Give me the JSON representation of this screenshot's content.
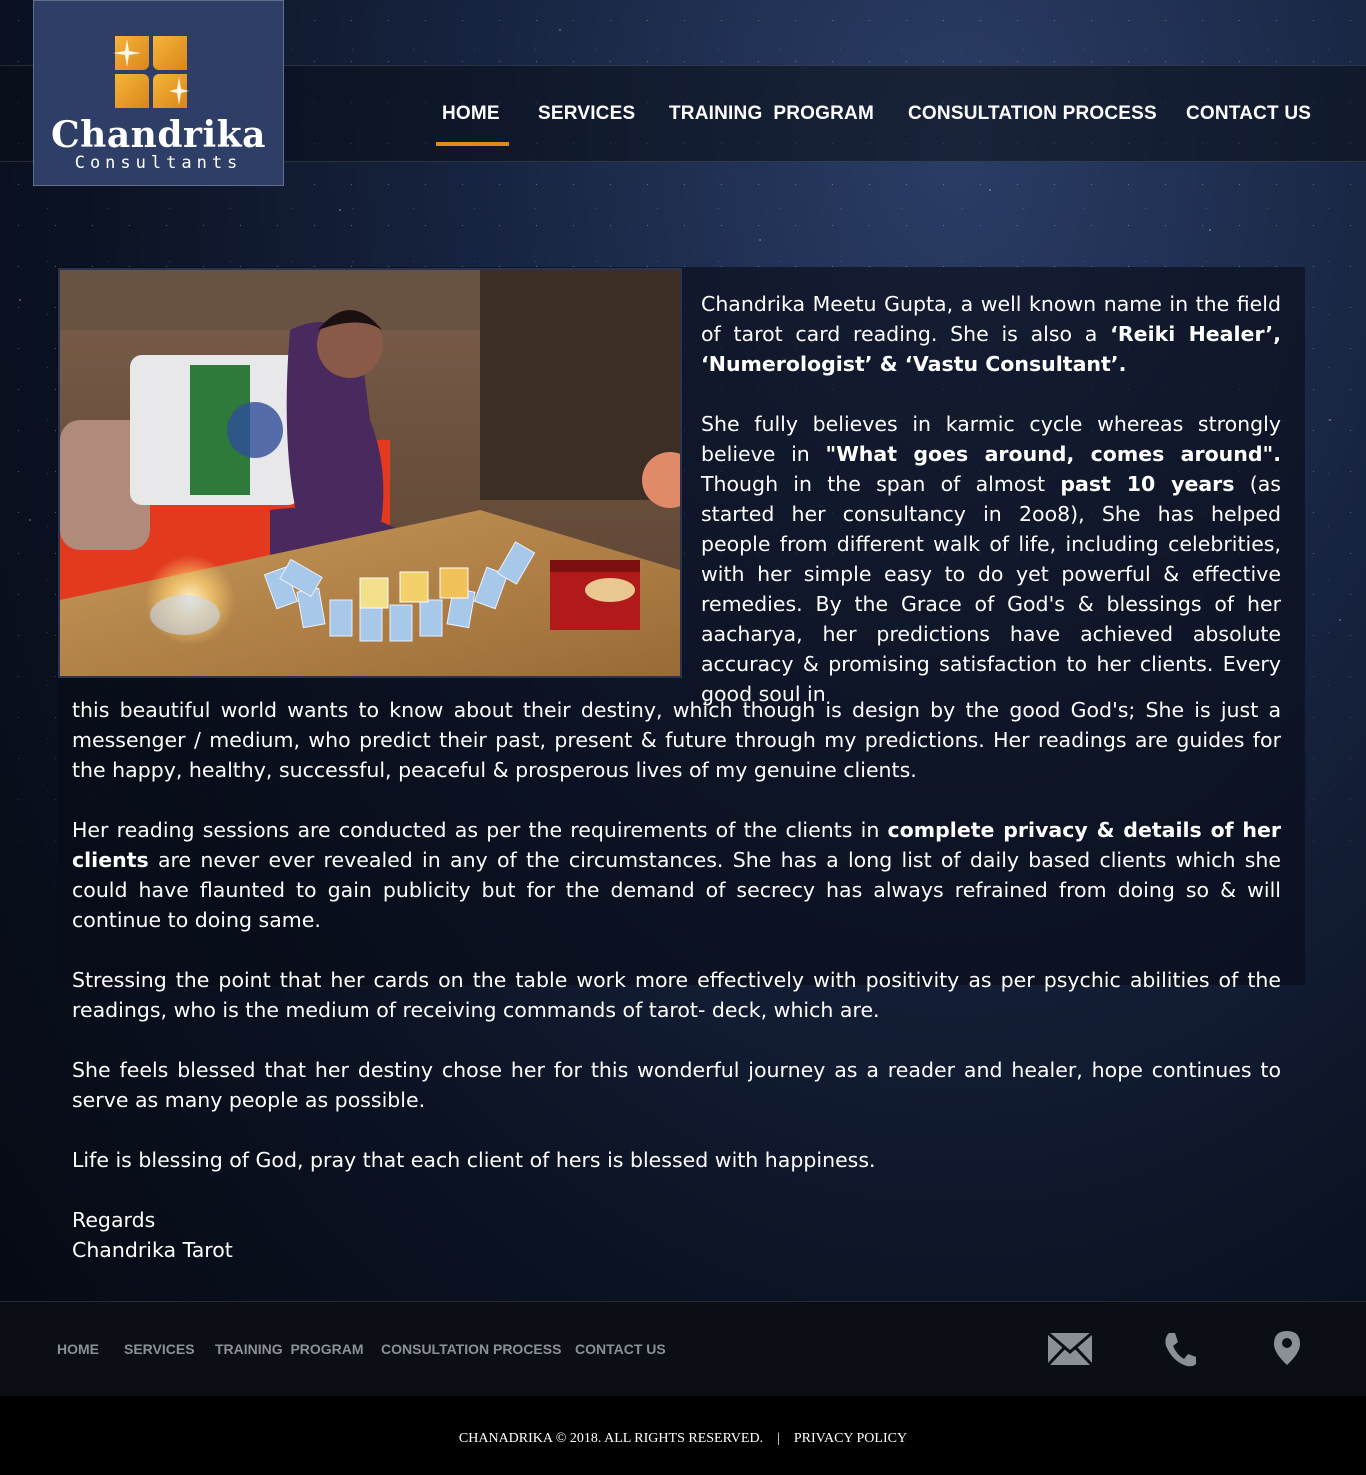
{
  "brand": {
    "name": "Chandrika",
    "tagline": "Consultants"
  },
  "nav": {
    "items": [
      "HOME",
      "SERVICES",
      "TRAINING  PROGRAM",
      "CONSULTATION PROCESS",
      "CONTACT US"
    ],
    "active": "HOME"
  },
  "content": {
    "p1": {
      "a": "Chandrika Meetu Gupta, a well known name in the field of tarot card reading. She is also a ",
      "b": "‘Reiki Healer’, ‘Numerologist’ & ‘Vastu Consultant’",
      "c": "."
    },
    "p2": {
      "a": "She fully believes in karmic cycle whereas strongly believe in ",
      "b": "\"What goes around, comes around\".",
      "c": " Though in the span of almost ",
      "d": "past 10 years",
      "e": " (as started her consultancy in 2oo8), She has helped people from different walk of life, including celebrities, with her simple easy to do yet powerful & effective remedies. By the Grace of God's & blessings of her aacharya, her predictions have achieved absolute accuracy & promising satisfaction to her clients. Every good soul in"
    },
    "p3": " this beautiful world wants to know about their destiny, which though is design by the good God's; She is just a messenger / medium, who predict their past, present & future through my predictions. Her readings are guides for the happy, healthy, successful, peaceful & prosperous lives of my  genuine clients.",
    "p4": {
      "a": "Her reading sessions are conducted as per the requirements of the clients in ",
      "b": "complete privacy & details of her clients",
      "c": " are never ever revealed in any of the circumstances. She has a long list of daily based clients which she could have flaunted to gain publicity but for the demand of secrecy has always refrained from doing so & will continue to doing same."
    },
    "p5": "Stressing the point that her cards on the table work more effectively with positivity as per psychic abilities of the readings, who is the medium of receiving commands of tarot- deck, which are.",
    "p6": "She feels blessed that her destiny chose her for this wonderful journey as a reader and healer, hope continues to serve as many people as possible.",
    "p7": "Life is blessing of God, pray that each client of hers is blessed with happiness.",
    "regards": "Regards",
    "signature": "Chandrika Tarot"
  },
  "footer": {
    "nav": [
      "HOME",
      "SERVICES",
      "TRAINING  PROGRAM",
      "CONSULTATION PROCESS",
      "CONTACT US"
    ],
    "icons": [
      "mail-icon",
      "phone-icon",
      "location-pin-icon"
    ],
    "copyright": "CHANADRIKA © 2018. ALL RIGHTS RESERVED.    |    PRIVACY POLICY"
  },
  "colors": {
    "accent": "#e38a1c",
    "logo_bg": "#2e3e66",
    "footer_text": "#8b8f96"
  }
}
